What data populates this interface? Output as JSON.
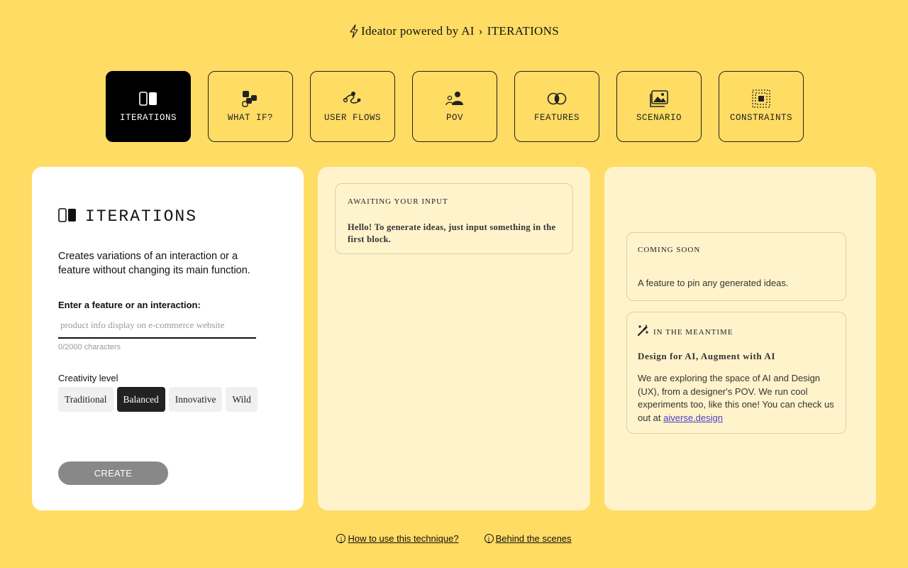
{
  "header": {
    "icon": "bolt-icon",
    "app_name": "Ideator powered by AI",
    "separator": "›",
    "current": "ITERATIONS"
  },
  "tabs": [
    {
      "label": "ITERATIONS",
      "icon": "iterations-icon",
      "active": true
    },
    {
      "label": "WHAT IF?",
      "icon": "what-if-icon",
      "active": false
    },
    {
      "label": "USER FLOWS",
      "icon": "user-flows-icon",
      "active": false
    },
    {
      "label": "POV",
      "icon": "pov-icon",
      "active": false
    },
    {
      "label": "FEATURES",
      "icon": "features-icon",
      "active": false
    },
    {
      "label": "SCENARIO",
      "icon": "scenario-icon",
      "active": false
    },
    {
      "label": "CONSTRAINTS",
      "icon": "constraints-icon",
      "active": false
    }
  ],
  "technique": {
    "title": "ITERATIONS",
    "description": "Creates variations of an interaction or a feature without changing its main function.",
    "input_label": "Enter a feature or an interaction:",
    "input_value": "",
    "input_placeholder": "product info display on e-commerce website",
    "char_count": "0/2000 characters",
    "creativity_label": "Creativity level",
    "levels": [
      "Traditional",
      "Balanced",
      "Innovative",
      "Wild"
    ],
    "selected_level": "Balanced",
    "create_label": "CREATE"
  },
  "output": {
    "eyebrow": "AWAITING YOUR INPUT",
    "message": "Hello! To generate ideas, just input something in the first block."
  },
  "side": {
    "soon_eyebrow": "COMING SOON",
    "soon_text": "A feature to pin any generated ideas.",
    "meantime_eyebrow": "IN THE MEANTIME",
    "meantime_icon": "magic-wand-icon",
    "meantime_title": "Design for AI, Augment with AI",
    "meantime_body": "We are exploring the space of AI and Design (UX), from a designer's POV. We run cool experiments too, like this one! You can check us out at",
    "meantime_link": "aiverse.design"
  },
  "footer": {
    "how_to": "How to use this technique?",
    "behind": "Behind the scenes"
  },
  "colors": {
    "background": "#ffdc64",
    "panel_light": "#fff3cc",
    "active_tab": "#000000",
    "create_button": "#888888",
    "link": "#4a3fc4"
  }
}
